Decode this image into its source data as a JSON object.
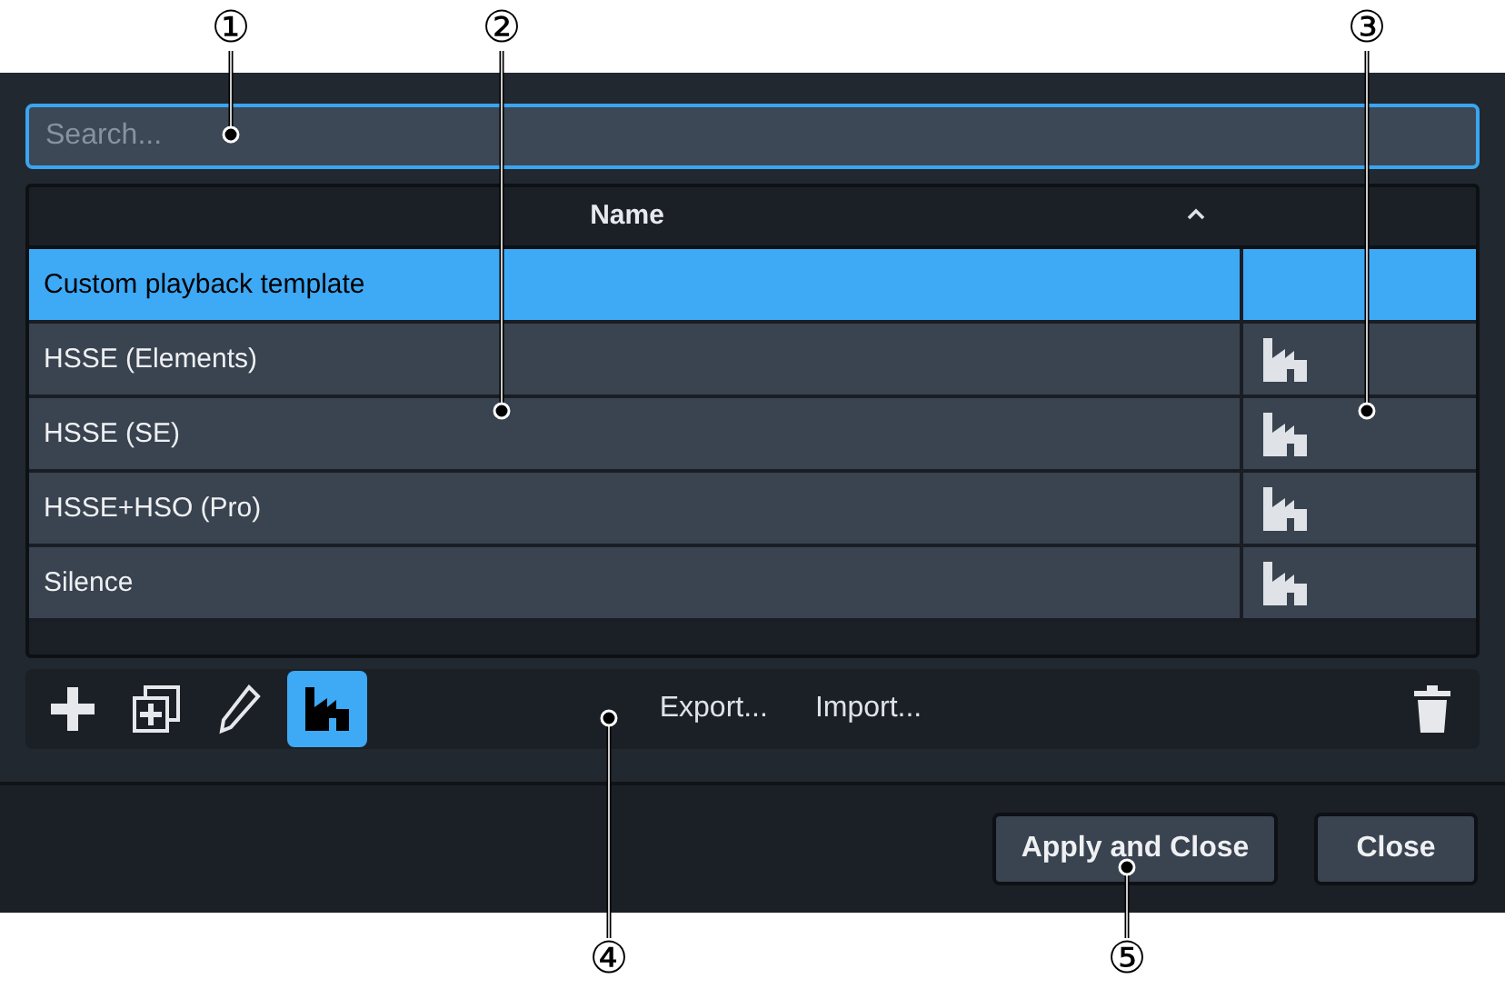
{
  "search": {
    "placeholder": "Search..."
  },
  "table": {
    "columns": [
      {
        "label": "Name"
      }
    ],
    "rows": [
      {
        "name": "Custom playback template",
        "factory": false,
        "selected": true
      },
      {
        "name": "HSSE (Elements)",
        "factory": true,
        "selected": false
      },
      {
        "name": "HSSE (SE)",
        "factory": true,
        "selected": false
      },
      {
        "name": "HSSE+HSO (Pro)",
        "factory": true,
        "selected": false
      },
      {
        "name": "Silence",
        "factory": true,
        "selected": false
      }
    ]
  },
  "toolbar": {
    "tools": [
      {
        "kind": "add",
        "selected": false
      },
      {
        "kind": "duplicate",
        "selected": false
      },
      {
        "kind": "edit",
        "selected": false
      },
      {
        "kind": "factory",
        "selected": true
      }
    ],
    "links": [
      "Export...",
      "Import..."
    ]
  },
  "buttons": [
    "Apply and Close",
    "Close"
  ],
  "callouts": [
    "①",
    "②",
    "③",
    "④",
    "⑤"
  ]
}
